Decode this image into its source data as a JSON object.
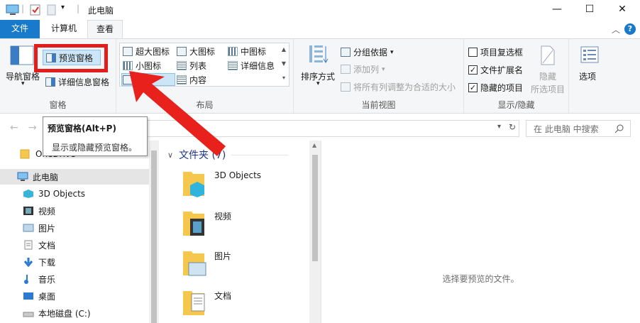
{
  "window": {
    "title": "此电脑",
    "controls": {
      "minimize": "—",
      "maximize": "☐",
      "close": "✕"
    }
  },
  "tabs": [
    {
      "label": "文件"
    },
    {
      "label": "计算机"
    },
    {
      "label": "查看"
    }
  ],
  "ribbon": {
    "panes": {
      "nav_pane": "导航窗格",
      "preview_pane": "预览窗格",
      "details_pane": "详细信息窗格",
      "label": "窗格"
    },
    "layout": {
      "items": [
        "超大图标",
        "大图标",
        "中图标",
        "小图标",
        "列表",
        "详细信息",
        "平铺",
        "内容"
      ],
      "label": "布局"
    },
    "current_view": {
      "sort": "排序方式",
      "group_by": "分组依据",
      "add_column": "添加列",
      "fit_columns": "将所有列调整为合适的大小",
      "label": "当前视图"
    },
    "show_hide": {
      "item_checkboxes": "项目复选框",
      "file_extensions": "文件扩展名",
      "hidden_items": "隐藏的项目",
      "hide_selected_1": "隐藏",
      "hide_selected_2": "所选项目",
      "label": "显示/隐藏",
      "checks": {
        "item_checkboxes": "",
        "file_extensions": "✓",
        "hidden_items": "✓"
      }
    },
    "options": "选项"
  },
  "tooltip": {
    "title": "预览窗格(Alt+P)",
    "description": "显示或隐藏预览窗格。"
  },
  "search": {
    "placeholder": "在 此电脑 中搜索"
  },
  "nav": {
    "items": [
      {
        "label": "OneDrive"
      },
      {
        "label": "此电脑"
      },
      {
        "label": "3D Objects"
      },
      {
        "label": "视频"
      },
      {
        "label": "图片"
      },
      {
        "label": "文档"
      },
      {
        "label": "下载"
      },
      {
        "label": "音乐"
      },
      {
        "label": "桌面"
      },
      {
        "label": "本地磁盘 (C:)"
      }
    ]
  },
  "content": {
    "section": "文件夹 (7)",
    "folders": [
      {
        "name": "3D Objects"
      },
      {
        "name": "视频"
      },
      {
        "name": "图片"
      },
      {
        "name": "文档"
      }
    ]
  },
  "preview": {
    "message": "选择要预览的文件。"
  },
  "colors": {
    "accent": "#1979ca",
    "highlight": "#e31c1c",
    "selected": "#cde6f7"
  }
}
